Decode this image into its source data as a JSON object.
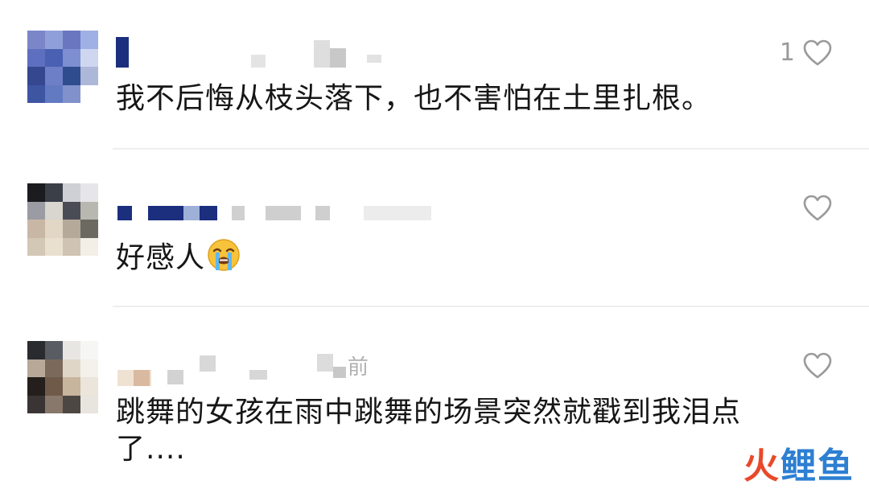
{
  "comments": [
    {
      "text": "我不后悔从枝头落下，也不害怕在土里扎根。",
      "like_count": "1",
      "avatar_colors": [
        "#7b86c9",
        "#8fa0d8",
        "#6a77c0",
        "#9fb1e4",
        "#5d6fbe",
        "#4960b3",
        "#7d8fd0",
        "#cfd6f0",
        "#34478f",
        "#6d7fc7",
        "#2f4c8e",
        "#adb7d8",
        "#3e55a2",
        "#617ac2",
        "#8091cc",
        "#ffffff"
      ]
    },
    {
      "text": "好感人",
      "emoji": "crying-face",
      "like_count": "",
      "avatar_colors": [
        "#1c1c20",
        "#3b3f48",
        "#cfcfd6",
        "#e6e6ea",
        "#9b9ba3",
        "#d8d6cf",
        "#4a4c55",
        "#b9b8b0",
        "#c9b7a6",
        "#e2d7c4",
        "#b5a99a",
        "#6c6960",
        "#d3c7b6",
        "#e9e0d0",
        "#cfc4b3",
        "#f3eee6"
      ]
    },
    {
      "text": "跳舞的女孩在雨中跳舞的场景突然就戳到我泪点了....",
      "like_count": "",
      "avatar_colors": [
        "#2a2b2f",
        "#5a5c63",
        "#e7e6e2",
        "#f6f6f5",
        "#b8a898",
        "#7b6a5b",
        "#e0d6c8",
        "#f4f1ec",
        "#241f1c",
        "#6f5a49",
        "#c8b59e",
        "#ebe5db",
        "#3a3534",
        "#87786b",
        "#4d4744",
        "#e8e4de"
      ]
    }
  ],
  "partial_time_label": "前",
  "watermark": {
    "chars": [
      "火",
      "鲤",
      "鱼"
    ],
    "colors": [
      "#e8492a",
      "#2d7fd2",
      "#2d7fd2"
    ]
  }
}
